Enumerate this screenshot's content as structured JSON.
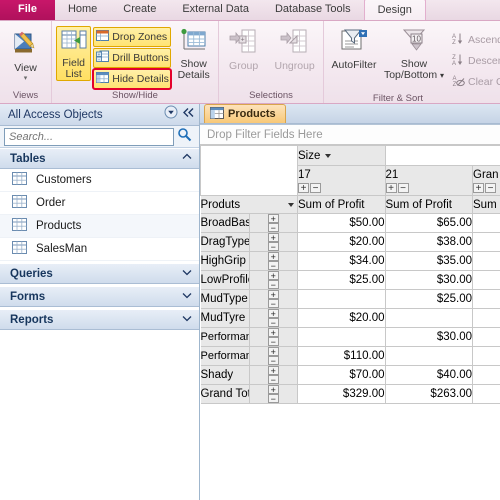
{
  "window": {
    "tabs": [
      {
        "label": "File",
        "state": "file"
      },
      {
        "label": "Home",
        "state": "normal"
      },
      {
        "label": "Create",
        "state": "normal"
      },
      {
        "label": "External Data",
        "state": "normal"
      },
      {
        "label": "Database Tools",
        "state": "normal"
      },
      {
        "label": "Design",
        "state": "active"
      }
    ]
  },
  "ribbon": {
    "groups": [
      {
        "title": "Views"
      },
      {
        "title": "Show/Hide"
      },
      {
        "title": "Selections"
      },
      {
        "title": "Filter & Sort"
      }
    ],
    "views": {
      "view_label": "View",
      "view_arrow": "▾",
      "icon": "view-design-icon"
    },
    "showhide": {
      "field_list_line1": "Field",
      "field_list_line2": "List",
      "field_list_icon": "field-list-icon",
      "drop_zones": "Drop Zones",
      "drop_zones_icon": "drop-zones-icon",
      "drill_buttons": "Drill Buttons",
      "drill_buttons_icon": "drill-buttons-icon",
      "hide_details": "Hide Details",
      "hide_details_icon": "hide-details-icon",
      "show_details_line1": "Show",
      "show_details_line2": "Details",
      "show_details_icon": "show-details-icon"
    },
    "selections": {
      "group": "Group",
      "group_icon": "group-icon",
      "ungroup": "Ungroup",
      "ungroup_icon": "ungroup-icon"
    },
    "filtersort": {
      "autofilter": "AutoFilter",
      "autofilter_icon": "autofilter-icon",
      "show_topbottom_line1": "Show",
      "show_topbottom_line2": "Top/Bottom",
      "show_topbottom_arrow": "▾",
      "show_topbottom_icon": "top-bottom-icon",
      "ascending": "Ascendin",
      "ascending_icon": "sort-ascending-icon",
      "descending": "Descend",
      "descending_icon": "sort-descending-icon",
      "clear_custom": "Clear Cu",
      "clear_custom_icon": "clear-filter-icon"
    }
  },
  "navpane": {
    "title": "All Access Objects",
    "menu_icon": "dropdown-circle-icon",
    "collapse_icon": "double-chevron-left-icon",
    "search_placeholder": "Search...",
    "search_value": "",
    "search_icon": "search-icon",
    "groups": [
      {
        "label": "Tables",
        "expanded": true,
        "chevron": "chevron-up-icon",
        "items": [
          {
            "label": "Customers",
            "icon": "table-icon"
          },
          {
            "label": "Order",
            "icon": "table-icon"
          },
          {
            "label": "Products",
            "icon": "table-icon"
          },
          {
            "label": "SalesMan",
            "icon": "table-icon"
          }
        ]
      },
      {
        "label": "Queries",
        "expanded": false,
        "chevron": "chevron-down-icon",
        "items": []
      },
      {
        "label": "Forms",
        "expanded": false,
        "chevron": "chevron-down-icon",
        "items": []
      },
      {
        "label": "Reports",
        "expanded": false,
        "chevron": "chevron-down-icon",
        "items": []
      }
    ]
  },
  "document": {
    "tab_label": "Products",
    "tab_icon": "pivottable-icon",
    "drop_filter_text": "Drop Filter Fields Here"
  },
  "pivot": {
    "column_field_label": "Size",
    "column_field_caret": "dropdown-caret-icon",
    "row_field_label": "Produts",
    "row_field_caret": "dropdown-caret-icon",
    "measure_label": "Sum of Profit",
    "expand_plus": "+",
    "collapse_minus": "−",
    "columns": [
      {
        "header": "17",
        "measure": "Sum of Profit"
      },
      {
        "header": "21",
        "measure": "Sum of Profit"
      },
      {
        "header": "Gran",
        "measure": "Sum"
      }
    ],
    "rows": [
      {
        "name": "BroadBase",
        "values": [
          "$50.00",
          "$65.00",
          ""
        ]
      },
      {
        "name": "DragType",
        "values": [
          "$20.00",
          "$38.00",
          ""
        ]
      },
      {
        "name": "HighGrip",
        "values": [
          "$34.00",
          "$35.00",
          ""
        ]
      },
      {
        "name": "LowProfile",
        "values": [
          "$25.00",
          "$30.00",
          ""
        ]
      },
      {
        "name": "MudType",
        "values": [
          "",
          "$25.00",
          ""
        ]
      },
      {
        "name": "MudTyre",
        "values": [
          "$20.00",
          "",
          ""
        ]
      },
      {
        "name": "Performance tyre",
        "values": [
          "",
          "$30.00",
          ""
        ]
      },
      {
        "name": "PerformanceType",
        "values": [
          "$110.00",
          "",
          ""
        ]
      },
      {
        "name": "Shady",
        "values": [
          "$70.00",
          "$40.00",
          ""
        ]
      },
      {
        "name": "Grand Total",
        "values": [
          "$329.00",
          "$263.00",
          ""
        ]
      }
    ]
  },
  "colors": {
    "file_tab": "#c9176a",
    "ribbon_accent": "#d9a8c4",
    "highlight_yellow": "#ffdf62",
    "annotation_red": "#e4002b",
    "doc_tab_orange": "#f8c877",
    "nav_header_blue": "#1f3864"
  }
}
